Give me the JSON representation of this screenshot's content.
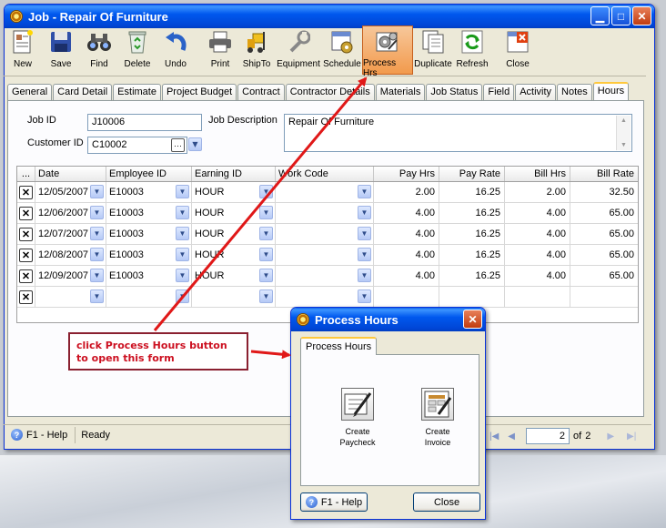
{
  "window": {
    "title": "Job - Repair Of Furniture"
  },
  "toolbar": [
    {
      "label": "New",
      "icon": "new-form-icon"
    },
    {
      "label": "Save",
      "icon": "floppy-disk-icon"
    },
    {
      "label": "Find",
      "icon": "binoculars-icon"
    },
    {
      "label": "Delete",
      "icon": "recycle-bin-icon"
    },
    {
      "label": "Undo",
      "icon": "undo-arrow-icon"
    },
    {
      "label": "Print",
      "icon": "printer-icon"
    },
    {
      "label": "ShipTo",
      "icon": "forklift-icon"
    },
    {
      "label": "Equipment",
      "icon": "wrench-icon"
    },
    {
      "label": "Schedule",
      "icon": "calendar-gear-icon"
    },
    {
      "label": "Process Hrs",
      "icon": "process-gears-icon"
    },
    {
      "label": "Duplicate",
      "icon": "duplicate-pages-icon"
    },
    {
      "label": "Refresh",
      "icon": "refresh-arrows-icon"
    },
    {
      "label": "Close",
      "icon": "close-window-icon"
    }
  ],
  "tabs": [
    "General",
    "Card Detail",
    "Estimate",
    "Project Budget",
    "Contract",
    "Contractor Details",
    "Materials",
    "Job Status",
    "Field",
    "Activity",
    "Notes",
    "Hours"
  ],
  "active_tab": "Hours",
  "form": {
    "job_id_label": "Job ID",
    "job_id_value": "J10006",
    "customer_id_label": "Customer ID",
    "customer_id_value": "C10002",
    "job_description_label": "Job Description",
    "job_description_value": "Repair Of Furniture"
  },
  "grid": {
    "columns": [
      "...",
      "Date",
      "Employee ID",
      "Earning ID",
      "Work Code",
      "Pay Hrs",
      "Pay Rate",
      "Bill Hrs",
      "Bill Rate"
    ],
    "rows": [
      {
        "date": "12/05/2007",
        "employee": "E10003",
        "earning": "HOUR",
        "work_code": "",
        "pay_hrs": "2.00",
        "pay_rate": "16.25",
        "bill_hrs": "2.00",
        "bill_rate": "32.50"
      },
      {
        "date": "12/06/2007",
        "employee": "E10003",
        "earning": "HOUR",
        "work_code": "",
        "pay_hrs": "4.00",
        "pay_rate": "16.25",
        "bill_hrs": "4.00",
        "bill_rate": "65.00"
      },
      {
        "date": "12/07/2007",
        "employee": "E10003",
        "earning": "HOUR",
        "work_code": "",
        "pay_hrs": "4.00",
        "pay_rate": "16.25",
        "bill_hrs": "4.00",
        "bill_rate": "65.00"
      },
      {
        "date": "12/08/2007",
        "employee": "E10003",
        "earning": "HOUR",
        "work_code": "",
        "pay_hrs": "4.00",
        "pay_rate": "16.25",
        "bill_hrs": "4.00",
        "bill_rate": "65.00"
      },
      {
        "date": "12/09/2007",
        "employee": "E10003",
        "earning": "HOUR",
        "work_code": "",
        "pay_hrs": "4.00",
        "pay_rate": "16.25",
        "bill_hrs": "4.00",
        "bill_rate": "65.00"
      },
      {
        "date": "",
        "employee": "",
        "earning": "",
        "work_code": "",
        "pay_hrs": "",
        "pay_rate": "",
        "bill_hrs": "",
        "bill_rate": ""
      }
    ]
  },
  "status": {
    "help": "F1 - Help",
    "message": "Ready",
    "page_current": "2",
    "page_of": "of",
    "page_total": "2"
  },
  "callout": {
    "text": "click Process Hours button to open this form"
  },
  "dialog": {
    "title": "Process Hours",
    "tab": "Process Hours",
    "create_paycheck": "Create Paycheck",
    "create_invoice": "Create Invoice",
    "help": "F1 - Help",
    "close": "Close"
  },
  "colors": {
    "titlebar": "#0058ee",
    "callout_text": "#cc1020",
    "arrow": "#e01818"
  }
}
